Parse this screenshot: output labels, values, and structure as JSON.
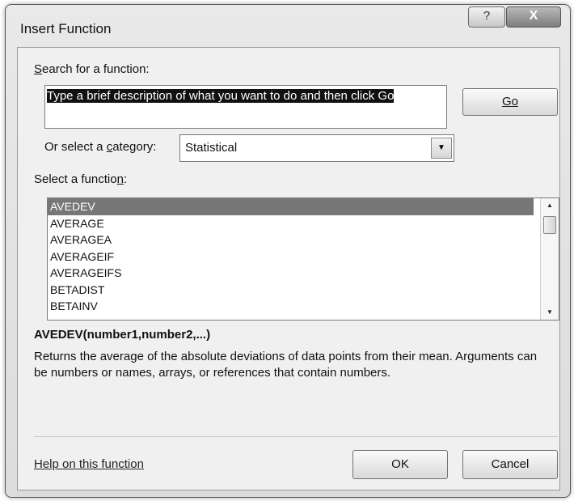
{
  "window": {
    "title": "Insert Function",
    "help_label": "?",
    "close_label": "X"
  },
  "search": {
    "label_prefix": "S",
    "label_rest": "earch for a function:",
    "value": "Type a brief description of what you want to do and then click Go",
    "go_label": "Go"
  },
  "category": {
    "label_prefix": "Or select a ",
    "label_accel": "c",
    "label_rest": "ategory:",
    "selected": "Statistical"
  },
  "functions": {
    "label_prefix": "Select a functio",
    "label_accel": "n",
    "label_rest": ":",
    "items": [
      "AVEDEV",
      "AVERAGE",
      "AVERAGEA",
      "AVERAGEIF",
      "AVERAGEIFS",
      "BETADIST",
      "BETAINV"
    ],
    "selected_index": 0
  },
  "details": {
    "signature": "AVEDEV(number1,number2,...)",
    "description": "Returns the average of the absolute deviations of data points from their mean. Arguments can be numbers or names, arrays, or references that contain numbers."
  },
  "footer": {
    "help_link": "Help on this function",
    "ok_label": "OK",
    "cancel_label": "Cancel"
  }
}
